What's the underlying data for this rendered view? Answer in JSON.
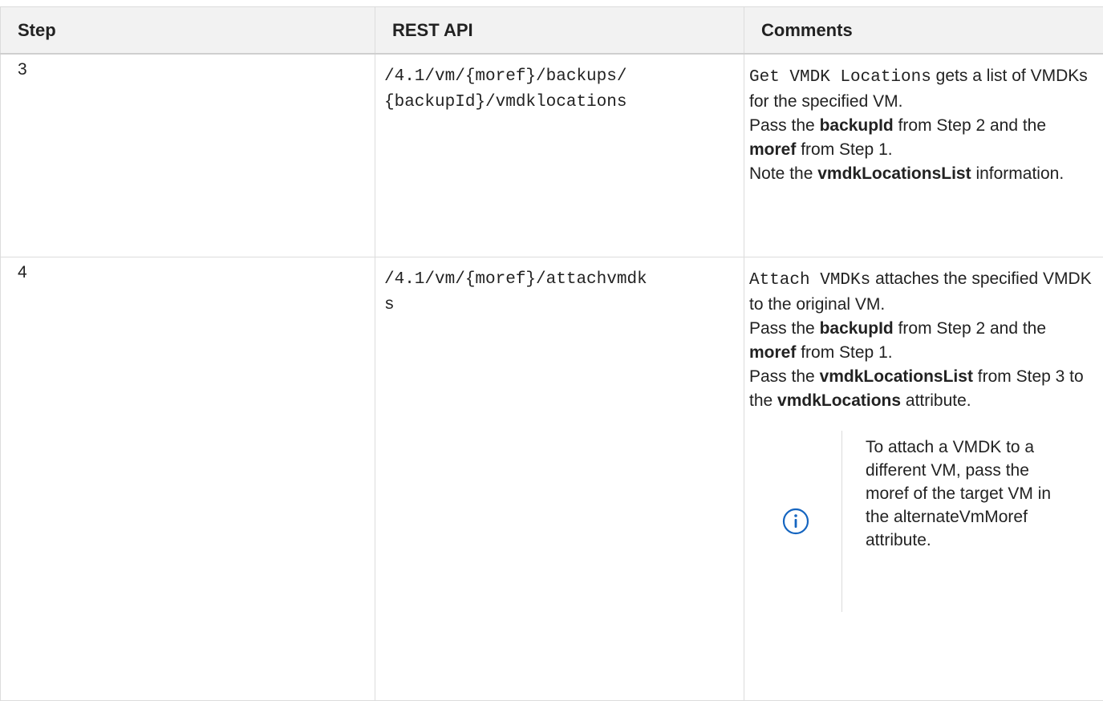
{
  "header": {
    "step": "Step",
    "rest_api": "REST API",
    "comments": "Comments"
  },
  "rows": [
    {
      "step": "3",
      "api_line1": "/4.1/vm/{moref}/backups/",
      "api_line2": "{backupId}/vmdklocations",
      "c": {
        "mono": "Get VMDK Locations",
        "t1": " gets a list of VMDKs for the specified VM.",
        "t2": "Pass the ",
        "b1": "backupId",
        "t3": " from Step 2 and the ",
        "b2": "moref",
        "t4": " from Step 1.",
        "t5": "Note the ",
        "b3": "vmdkLocationsList",
        "t6": " information."
      }
    },
    {
      "step": "4",
      "api_line1": "/4.1/vm/{moref}/attachvmdk",
      "api_line2": "s",
      "c": {
        "mono": "Attach VMDKs",
        "t1": " attaches the specified VMDK to the original VM.",
        "t2": "Pass the ",
        "b1": "backupId",
        "t3": " from Step 2 and the ",
        "b2": "moref",
        "t4": " from Step 1.",
        "t5": "Pass the ",
        "b3": "vmdkLocationsList",
        "t6": " from Step 3 to the ",
        "b4": "vmdkLocations",
        "t7": " attribute."
      },
      "note": {
        "icon": "info-icon",
        "text": "To attach a VMDK to a different VM, pass the moref of the target VM in the alternateVmMoref attribute."
      }
    }
  ],
  "colors": {
    "header_bg": "#f2f2f2",
    "border": "#dcdcdc",
    "info_icon": "#1565c0"
  }
}
